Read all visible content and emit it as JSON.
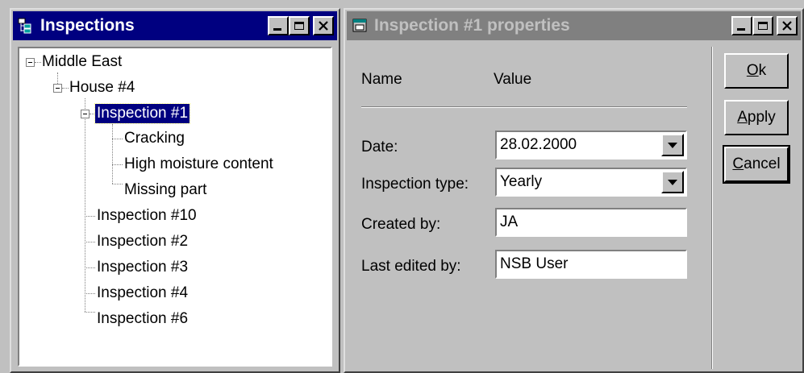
{
  "left_window": {
    "title": "Inspections",
    "tree": {
      "root": "Middle East",
      "house": "House #4",
      "selected": "Inspection #1",
      "children": [
        "Cracking",
        "High moisture content",
        "Missing part"
      ],
      "siblings": [
        "Inspection #10",
        "Inspection #2",
        "Inspection #3",
        "Inspection #4",
        "Inspection #6"
      ]
    }
  },
  "right_window": {
    "title": "Inspection #1 properties",
    "header": {
      "name": "Name",
      "value": "Value"
    },
    "fields": {
      "date_label": "Date:",
      "date_value": "28.02.2000",
      "type_label": "Inspection type:",
      "type_value": "Yearly",
      "created_label": "Created by:",
      "created_value": "JA",
      "edited_label": "Last edited by:",
      "edited_value": "NSB User"
    },
    "buttons": {
      "ok_first": "O",
      "ok_rest": "k",
      "apply_first": "A",
      "apply_rest": "pply",
      "cancel_first": "C",
      "cancel_rest": "ancel"
    }
  },
  "icons": [
    "tree-window-icon",
    "properties-window-icon",
    "minimize-icon",
    "maximize-icon",
    "close-icon"
  ],
  "colors": {
    "active_title": "#000080",
    "inactive_title": "#808080",
    "face": "#c0c0c0"
  }
}
